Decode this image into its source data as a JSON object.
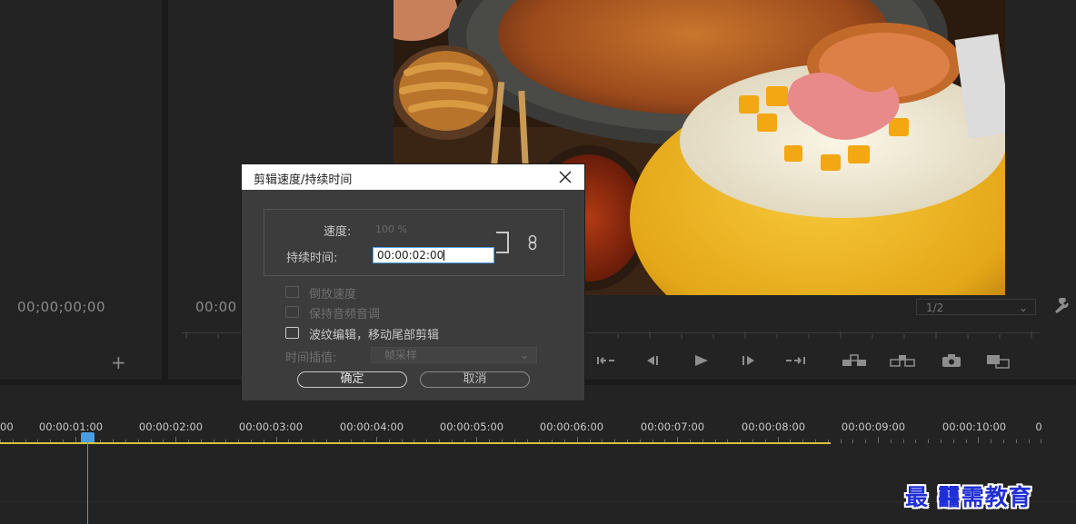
{
  "source_monitor": {
    "timecode": "00;00;00;00",
    "add_icon": "plus-icon"
  },
  "program_monitor": {
    "timecode": "00:00",
    "zoom_value": "1/2",
    "controls": [
      "step-back-icon",
      "rewind-icon",
      "play-icon",
      "fast-forward-icon",
      "step-forward-icon",
      "lift-icon",
      "extract-icon",
      "camera-icon",
      "compare-icon"
    ],
    "settings_icon": "wrench-icon"
  },
  "dialog": {
    "title": "剪辑速度/持续时间",
    "speed_label": "速度:",
    "speed_value": "100 %",
    "duration_label": "持续时间:",
    "duration_value": "00:00:02:00",
    "link_icon": "chain-link-icon",
    "reverse_label": "倒放速度",
    "keep_pitch_label": "保持音频音调",
    "ripple_label": "波纹编辑，移动尾部剪辑",
    "interp_label": "时间插值:",
    "interp_value": "帧采样",
    "ok_label": "确定",
    "cancel_label": "取消"
  },
  "timeline": {
    "ticks": [
      "00",
      "00:00:01:00",
      "00:00:02:00",
      "00:00:03:00",
      "00:00:04:00",
      "00:00:05:00",
      "00:00:06:00",
      "00:00:07:00",
      "00:00:08:00",
      "00:00:09:00",
      "00:00:10:00",
      "0"
    ],
    "playhead_timecode": "00:00:01:00",
    "colors": {
      "playhead": "#4a9de0",
      "work_area": "#d6c23c"
    }
  },
  "watermark": {
    "text": "最 䨻需教育"
  }
}
